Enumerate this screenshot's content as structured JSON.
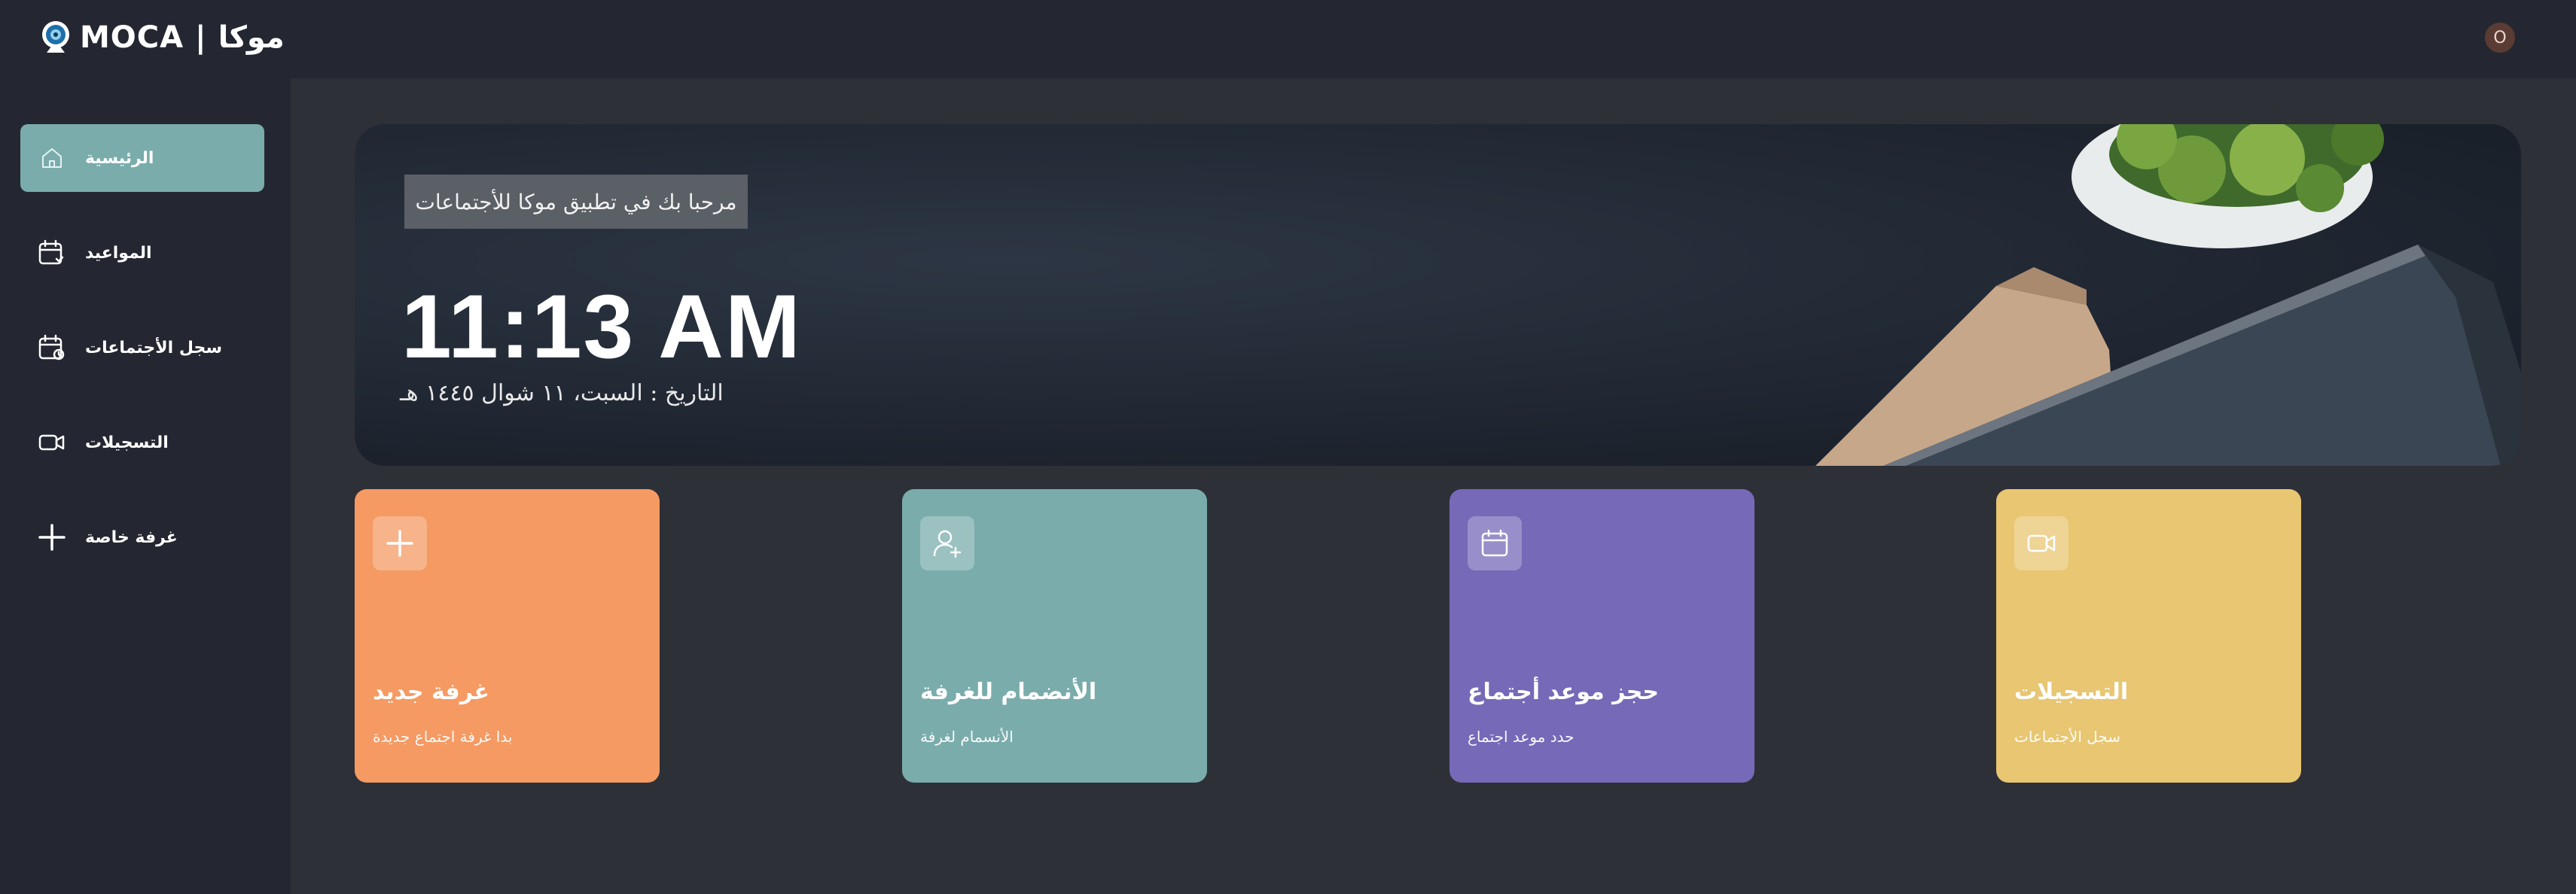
{
  "header": {
    "logo_text": "MOCA | موكا",
    "avatar_initial": "O",
    "logo_icon": "webcam-icon"
  },
  "sidebar": {
    "items": [
      {
        "label": "الرئيسية",
        "icon": "home-icon",
        "active": true
      },
      {
        "label": "المواعيد",
        "icon": "calendar-clock-icon",
        "active": false
      },
      {
        "label": "سجل الأجتماعات",
        "icon": "calendar-history-icon",
        "active": false
      },
      {
        "label": "التسجيلات",
        "icon": "video-icon",
        "active": false
      },
      {
        "label": "غرفة خاصة",
        "icon": "plus-icon",
        "active": false
      }
    ]
  },
  "hero": {
    "welcome": "مرحبا بك في تطبيق موكا للأجتماعات",
    "time": "11:13 AM",
    "date": "التاريخ : السبت، ١١ شوال ١٤٤٥ هـ"
  },
  "cards": [
    {
      "title": "غرفة جديد",
      "subtitle": "بدا غرفة اجتماع جديدة",
      "icon": "plus-icon",
      "color": "#f59a62"
    },
    {
      "title": "الأنضمام للغرفة",
      "subtitle": "الأنسمام لغرفة",
      "icon": "user-plus-icon",
      "color": "#7aacac"
    },
    {
      "title": "حجز موعد أجتماع",
      "subtitle": "حدد موعد اجتماع",
      "icon": "calendar-icon",
      "color": "#7669b7"
    },
    {
      "title": "التسجيلات",
      "subtitle": "سجل الأجتماعات",
      "icon": "video-icon",
      "color": "#e8c672"
    }
  ],
  "colors": {
    "background": "#2e3038",
    "panel": "#242731",
    "accent": "#7aacac"
  }
}
